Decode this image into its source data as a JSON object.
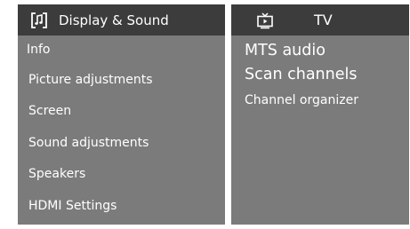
{
  "left_panel": {
    "icon": "music-note-box-icon",
    "title": "Display & Sound",
    "items": [
      {
        "label": "Info"
      },
      {
        "label": "Picture adjustments"
      },
      {
        "label": "Screen"
      },
      {
        "label": "Sound adjustments"
      },
      {
        "label": "Speakers"
      },
      {
        "label": "HDMI Settings"
      }
    ]
  },
  "right_panel": {
    "icon": "tv-icon",
    "title": "TV",
    "large_items": [
      {
        "label": "MTS audio"
      },
      {
        "label": "Scan channels"
      }
    ],
    "small_items": [
      {
        "label": "Channel organizer"
      }
    ]
  },
  "colors": {
    "panel_bg": "#7b7b7b",
    "header_bg": "#3c3c3c",
    "text": "#ffffff"
  }
}
